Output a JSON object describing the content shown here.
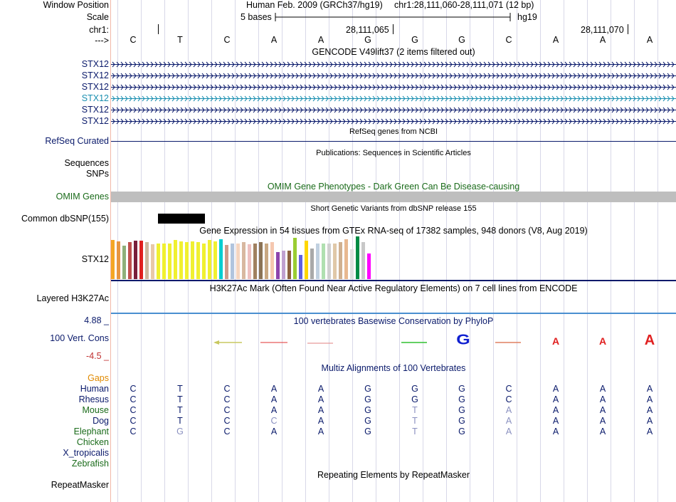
{
  "header": {
    "window_position_label": "Window Position",
    "scale_label": "Scale",
    "chr_label": "chr1:",
    "arrow_label": "--->",
    "assembly_text": "Human Feb. 2009 (GRCh37/hg19)",
    "position_text": "chr1:28,111,060-28,111,071 (12 bp)",
    "scale_text": "5 bases",
    "db_text": "hg19",
    "coord_1": "28,111,065",
    "coord_2": "28,111,070"
  },
  "bases": [
    "C",
    "T",
    "C",
    "A",
    "A",
    "G",
    "G",
    "G",
    "C",
    "A",
    "A",
    "A"
  ],
  "gencode": {
    "title": "GENCODE V49lift37 (2 items filtered out)",
    "items": [
      "STX12",
      "STX12",
      "STX12",
      "STX12",
      "STX12",
      "STX12"
    ],
    "colors": [
      "#0a1a6b",
      "#0a1a6b",
      "#0a1a6b",
      "#1a8fb0",
      "#0a1a6b",
      "#0a1a6b"
    ]
  },
  "refseq": {
    "title": "RefSeq genes from NCBI",
    "label": "RefSeq Curated"
  },
  "publications": {
    "title": "Publications: Sequences in Scientific Articles",
    "sequences_label": "Sequences",
    "snps_label": "SNPs"
  },
  "omim": {
    "title": "OMIM Gene Phenotypes - Dark Green Can Be Disease-causing",
    "label": "OMIM Genes"
  },
  "dbsnp": {
    "title": "Short Genetic Variants from dbSNP release 155",
    "label": "Common dbSNP(155)"
  },
  "gtex": {
    "title": "Gene Expression in 54 tissues from GTEx RNA-seq of 17382 samples, 948 donors (V8, Aug 2019)",
    "label": "STX12",
    "bars": [
      {
        "value": 0.92,
        "color": "#f5a623"
      },
      {
        "value": 0.88,
        "color": "#e89540"
      },
      {
        "value": 0.78,
        "color": "#8fb07a"
      },
      {
        "value": 0.86,
        "color": "#c0504d"
      },
      {
        "value": 0.9,
        "color": "#7a1f3a"
      },
      {
        "value": 0.9,
        "color": "#e02020"
      },
      {
        "value": 0.86,
        "color": "#cdb79e"
      },
      {
        "value": 0.82,
        "color": "#e8c9a8"
      },
      {
        "value": 0.84,
        "color": "#f0f030"
      },
      {
        "value": 0.84,
        "color": "#f0f030"
      },
      {
        "value": 0.84,
        "color": "#f0f030"
      },
      {
        "value": 0.92,
        "color": "#f0f030"
      },
      {
        "value": 0.88,
        "color": "#f0f030"
      },
      {
        "value": 0.86,
        "color": "#f0f030"
      },
      {
        "value": 0.88,
        "color": "#f0f030"
      },
      {
        "value": 0.86,
        "color": "#f0f030"
      },
      {
        "value": 0.84,
        "color": "#f0f030"
      },
      {
        "value": 0.92,
        "color": "#f0f030"
      },
      {
        "value": 0.88,
        "color": "#f0f030"
      },
      {
        "value": 0.94,
        "color": "#00ced1"
      },
      {
        "value": 0.8,
        "color": "#cd9b8a"
      },
      {
        "value": 0.84,
        "color": "#b0c4de"
      },
      {
        "value": 0.84,
        "color": "#f5d5c0"
      },
      {
        "value": 0.86,
        "color": "#d8b8a0"
      },
      {
        "value": 0.82,
        "color": "#eec0c0"
      },
      {
        "value": 0.84,
        "color": "#a08060"
      },
      {
        "value": 0.86,
        "color": "#8b7355"
      },
      {
        "value": 0.84,
        "color": "#c8a882"
      },
      {
        "value": 0.86,
        "color": "#f5c8b0"
      },
      {
        "value": 0.64,
        "color": "#8e44ad"
      },
      {
        "value": 0.66,
        "color": "#c0a0d0"
      },
      {
        "value": 0.66,
        "color": "#8c6040"
      },
      {
        "value": 0.96,
        "color": "#9acd32"
      },
      {
        "value": 0.56,
        "color": "#6060e0"
      },
      {
        "value": 0.9,
        "color": "#ffd700"
      },
      {
        "value": 0.72,
        "color": "#a9a9a9"
      },
      {
        "value": 0.84,
        "color": "#c0d0e0"
      },
      {
        "value": 0.84,
        "color": "#b0e0b0"
      },
      {
        "value": 0.84,
        "color": "#d0d0d0"
      },
      {
        "value": 0.84,
        "color": "#e0c8a8"
      },
      {
        "value": 0.86,
        "color": "#d0b090"
      },
      {
        "value": 0.94,
        "color": "#e8b890"
      },
      {
        "value": 0.7,
        "color": "#e0e0e0"
      },
      {
        "value": 1.0,
        "color": "#008b45"
      },
      {
        "value": 0.86,
        "color": "#c8c8c8"
      },
      {
        "value": 0.6,
        "color": "#ff00ff"
      }
    ]
  },
  "h3k27ac": {
    "title": "H3K27Ac Mark (Often Found Near Active Regulatory Elements) on 7 cell lines from ENCODE",
    "label": "Layered H3K27Ac"
  },
  "phylop": {
    "title": "100 vertebrates Basewise Conservation by PhyloP",
    "label": "100 Vert. Cons",
    "max_label": "4.88 _",
    "min_label": "-4.5 _"
  },
  "multiz": {
    "title": "Multiz Alignments of 100 Vertebrates",
    "gaps_label": "Gaps",
    "species": [
      {
        "name": "Human",
        "color": "#0a1a6b",
        "seq": [
          "C",
          "T",
          "C",
          "A",
          "A",
          "G",
          "G",
          "G",
          "C",
          "A",
          "A",
          "A"
        ],
        "faded": []
      },
      {
        "name": "Rhesus",
        "color": "#0a1a6b",
        "seq": [
          "C",
          "T",
          "C",
          "A",
          "A",
          "G",
          "G",
          "G",
          "C",
          "A",
          "A",
          "A"
        ],
        "faded": []
      },
      {
        "name": "Mouse",
        "color": "#1a6b1a",
        "seq": [
          "C",
          "T",
          "C",
          "A",
          "A",
          "G",
          "T",
          "G",
          "A",
          "A",
          "A",
          "A"
        ],
        "faded": [
          6,
          8
        ]
      },
      {
        "name": "Dog",
        "color": "#0a1a6b",
        "seq": [
          "C",
          "T",
          "C",
          "C",
          "A",
          "G",
          "T",
          "G",
          "A",
          "A",
          "A",
          "A"
        ],
        "faded": [
          3,
          6,
          8
        ]
      },
      {
        "name": "Elephant",
        "color": "#1a6b1a",
        "seq": [
          "C",
          "G",
          "C",
          "A",
          "A",
          "G",
          "T",
          "G",
          "A",
          "A",
          "A",
          "A"
        ],
        "faded": [
          1,
          6,
          8
        ]
      },
      {
        "name": "Chicken",
        "color": "#1a6b1a",
        "seq": [],
        "faded": []
      },
      {
        "name": "X_tropicalis",
        "color": "#0a1a6b",
        "seq": [],
        "faded": []
      },
      {
        "name": "Zebrafish",
        "color": "#1a6b1a",
        "seq": [],
        "faded": []
      }
    ]
  },
  "repeatmasker": {
    "title": "Repeating Elements by RepeatMasker",
    "label": "RepeatMasker"
  }
}
